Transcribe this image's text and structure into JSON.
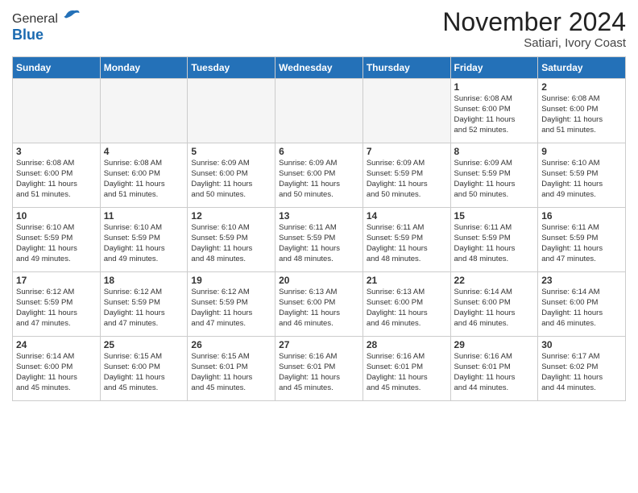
{
  "header": {
    "logo_general": "General",
    "logo_blue": "Blue",
    "month": "November 2024",
    "location": "Satiari, Ivory Coast"
  },
  "weekdays": [
    "Sunday",
    "Monday",
    "Tuesday",
    "Wednesday",
    "Thursday",
    "Friday",
    "Saturday"
  ],
  "weeks": [
    [
      {
        "day": "",
        "info": ""
      },
      {
        "day": "",
        "info": ""
      },
      {
        "day": "",
        "info": ""
      },
      {
        "day": "",
        "info": ""
      },
      {
        "day": "",
        "info": ""
      },
      {
        "day": "1",
        "info": "Sunrise: 6:08 AM\nSunset: 6:00 PM\nDaylight: 11 hours\nand 52 minutes."
      },
      {
        "day": "2",
        "info": "Sunrise: 6:08 AM\nSunset: 6:00 PM\nDaylight: 11 hours\nand 51 minutes."
      }
    ],
    [
      {
        "day": "3",
        "info": "Sunrise: 6:08 AM\nSunset: 6:00 PM\nDaylight: 11 hours\nand 51 minutes."
      },
      {
        "day": "4",
        "info": "Sunrise: 6:08 AM\nSunset: 6:00 PM\nDaylight: 11 hours\nand 51 minutes."
      },
      {
        "day": "5",
        "info": "Sunrise: 6:09 AM\nSunset: 6:00 PM\nDaylight: 11 hours\nand 50 minutes."
      },
      {
        "day": "6",
        "info": "Sunrise: 6:09 AM\nSunset: 6:00 PM\nDaylight: 11 hours\nand 50 minutes."
      },
      {
        "day": "7",
        "info": "Sunrise: 6:09 AM\nSunset: 5:59 PM\nDaylight: 11 hours\nand 50 minutes."
      },
      {
        "day": "8",
        "info": "Sunrise: 6:09 AM\nSunset: 5:59 PM\nDaylight: 11 hours\nand 50 minutes."
      },
      {
        "day": "9",
        "info": "Sunrise: 6:10 AM\nSunset: 5:59 PM\nDaylight: 11 hours\nand 49 minutes."
      }
    ],
    [
      {
        "day": "10",
        "info": "Sunrise: 6:10 AM\nSunset: 5:59 PM\nDaylight: 11 hours\nand 49 minutes."
      },
      {
        "day": "11",
        "info": "Sunrise: 6:10 AM\nSunset: 5:59 PM\nDaylight: 11 hours\nand 49 minutes."
      },
      {
        "day": "12",
        "info": "Sunrise: 6:10 AM\nSunset: 5:59 PM\nDaylight: 11 hours\nand 48 minutes."
      },
      {
        "day": "13",
        "info": "Sunrise: 6:11 AM\nSunset: 5:59 PM\nDaylight: 11 hours\nand 48 minutes."
      },
      {
        "day": "14",
        "info": "Sunrise: 6:11 AM\nSunset: 5:59 PM\nDaylight: 11 hours\nand 48 minutes."
      },
      {
        "day": "15",
        "info": "Sunrise: 6:11 AM\nSunset: 5:59 PM\nDaylight: 11 hours\nand 48 minutes."
      },
      {
        "day": "16",
        "info": "Sunrise: 6:11 AM\nSunset: 5:59 PM\nDaylight: 11 hours\nand 47 minutes."
      }
    ],
    [
      {
        "day": "17",
        "info": "Sunrise: 6:12 AM\nSunset: 5:59 PM\nDaylight: 11 hours\nand 47 minutes."
      },
      {
        "day": "18",
        "info": "Sunrise: 6:12 AM\nSunset: 5:59 PM\nDaylight: 11 hours\nand 47 minutes."
      },
      {
        "day": "19",
        "info": "Sunrise: 6:12 AM\nSunset: 5:59 PM\nDaylight: 11 hours\nand 47 minutes."
      },
      {
        "day": "20",
        "info": "Sunrise: 6:13 AM\nSunset: 6:00 PM\nDaylight: 11 hours\nand 46 minutes."
      },
      {
        "day": "21",
        "info": "Sunrise: 6:13 AM\nSunset: 6:00 PM\nDaylight: 11 hours\nand 46 minutes."
      },
      {
        "day": "22",
        "info": "Sunrise: 6:14 AM\nSunset: 6:00 PM\nDaylight: 11 hours\nand 46 minutes."
      },
      {
        "day": "23",
        "info": "Sunrise: 6:14 AM\nSunset: 6:00 PM\nDaylight: 11 hours\nand 46 minutes."
      }
    ],
    [
      {
        "day": "24",
        "info": "Sunrise: 6:14 AM\nSunset: 6:00 PM\nDaylight: 11 hours\nand 45 minutes."
      },
      {
        "day": "25",
        "info": "Sunrise: 6:15 AM\nSunset: 6:00 PM\nDaylight: 11 hours\nand 45 minutes."
      },
      {
        "day": "26",
        "info": "Sunrise: 6:15 AM\nSunset: 6:01 PM\nDaylight: 11 hours\nand 45 minutes."
      },
      {
        "day": "27",
        "info": "Sunrise: 6:16 AM\nSunset: 6:01 PM\nDaylight: 11 hours\nand 45 minutes."
      },
      {
        "day": "28",
        "info": "Sunrise: 6:16 AM\nSunset: 6:01 PM\nDaylight: 11 hours\nand 45 minutes."
      },
      {
        "day": "29",
        "info": "Sunrise: 6:16 AM\nSunset: 6:01 PM\nDaylight: 11 hours\nand 44 minutes."
      },
      {
        "day": "30",
        "info": "Sunrise: 6:17 AM\nSunset: 6:02 PM\nDaylight: 11 hours\nand 44 minutes."
      }
    ]
  ]
}
